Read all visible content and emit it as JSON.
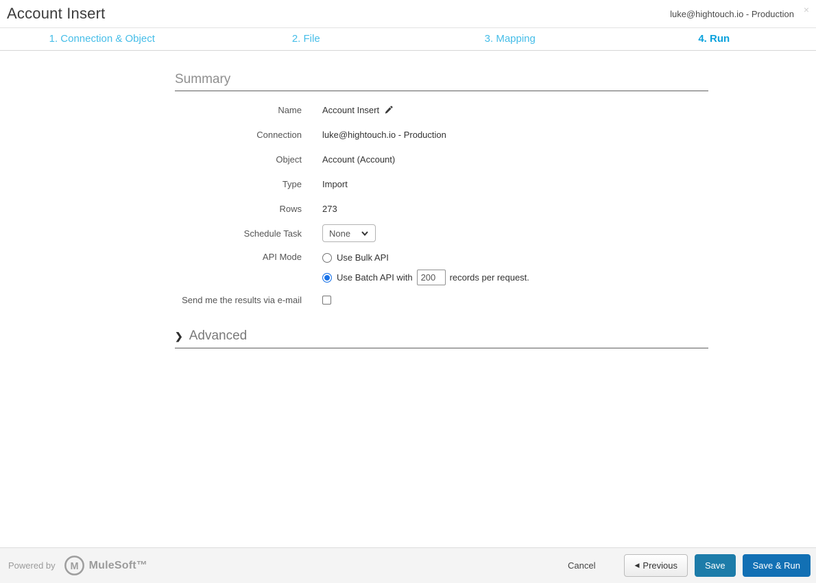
{
  "header": {
    "title": "Account Insert",
    "connection_label": "luke@hightouch.io - Production",
    "close_glyph": "×"
  },
  "tabs": [
    {
      "label": "1. Connection & Object",
      "active": false
    },
    {
      "label": "2. File",
      "active": false
    },
    {
      "label": "3. Mapping",
      "active": false
    },
    {
      "label": "4. Run",
      "active": true
    }
  ],
  "summary": {
    "heading": "Summary",
    "name": {
      "label": "Name",
      "value": "Account Insert"
    },
    "connection": {
      "label": "Connection",
      "value": "luke@hightouch.io - Production"
    },
    "object": {
      "label": "Object",
      "value": "Account (Account)"
    },
    "type": {
      "label": "Type",
      "value": "Import"
    },
    "rows": {
      "label": "Rows",
      "value": "273"
    },
    "schedule": {
      "label": "Schedule Task",
      "selected_option": "None"
    },
    "api_mode": {
      "label": "API Mode",
      "bulk_option": "Use Bulk API",
      "bulk_selected": false,
      "batch_prefix": "Use Batch API with",
      "batch_size": "200",
      "batch_suffix": "records per request.",
      "batch_selected": true
    },
    "email": {
      "label": "Send me the results via e-mail",
      "checked": false
    },
    "advanced_label": "Advanced",
    "advanced_chevron": "❯"
  },
  "footer": {
    "powered_by": "Powered by",
    "brand": "MuleSoft™",
    "cancel_label": "Cancel",
    "previous_label": "Previous",
    "previous_arrow": "◀",
    "save_label": "Save",
    "save_run_label": "Save & Run"
  },
  "icons": {
    "edit": "pencil-icon",
    "select_chevron": "chevron-down-icon",
    "advanced": "chevron-right-icon",
    "logo": "mulesoft-logo"
  },
  "colors": {
    "tab_inactive": "#45bde8",
    "tab_active": "#0ca2dc",
    "save_button": "#1d7ca9",
    "save_run_button": "#1270b4",
    "radio_selected": "#1a73e8",
    "footer_bg": "#f4f4f4"
  }
}
